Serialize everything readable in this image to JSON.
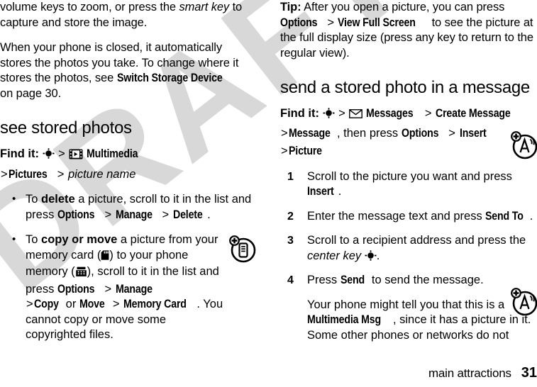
{
  "document": {
    "watermark_text": "DRAFT",
    "watermark_color": "#d8d8d8",
    "text_color": "#000000",
    "background_color": "#ffffff"
  },
  "left_column": {
    "para_continued": {
      "part1": "volume keys to zoom, or press the ",
      "italic1": "smart key",
      "part2": " to capture and store the image."
    },
    "para_storage": {
      "part1": "When your phone is closed, it automatically stores the photos you take. To change where it stores the photos, see ",
      "ui1": "Switch Storage Device",
      "part2": " on page 30."
    },
    "section_heading": "see stored photos",
    "find_it": {
      "label": "Find it:",
      "centerkey_icon": "center-key-icon",
      "sep1": ">",
      "multimedia_icon": "multimedia-film-icon",
      "multimedia": "Multimedia",
      "sep2": ">",
      "pictures": "Pictures",
      "sep3": ">",
      "picture_name": "picture name"
    },
    "bullets": [
      {
        "part1": "To ",
        "bold1": "delete",
        "part2": " a picture, scroll to it in the list and press ",
        "ui1": "Options",
        "sep1": ">",
        "ui2": "Manage",
        "sep2": ">",
        "ui3": "Delete",
        "part3": "."
      },
      {
        "part1": "To ",
        "bold1": "copy or move",
        "part2": " a picture from your memory card (",
        "icon1": "memory-card-icon",
        "part3": ") to your phone memory (",
        "icon2": "phone-memory-icon",
        "part4": "), scroll to it in the list and press ",
        "ui1": "Options",
        "sep1": ">",
        "ui2": "Manage",
        "sep2": ">",
        "ui3": "Copy",
        "or": " or ",
        "ui4": "Move",
        "sep3": ">",
        "ui5": "Memory Card",
        "part5": ". You cannot copy or move some copyrighted files."
      }
    ]
  },
  "right_column": {
    "tip": {
      "label": "Tip:",
      "part1": " After you open a picture, you can press ",
      "ui1": "Options",
      "sep1": ">",
      "ui2": "View Full Screen",
      "part2": " to see the picture at the full display size (press any key to return to the regular view)."
    },
    "section_heading": "send a stored photo in a message",
    "find_it": {
      "label": "Find it:",
      "centerkey_icon": "center-key-icon",
      "sep1": ">",
      "messages_icon": "envelope-icon",
      "messages": "Messages",
      "sep2": ">",
      "create_message": "Create Message",
      "sep3": ">",
      "message": "Message",
      "then_press": ", then press ",
      "options": "Options",
      "sep4": ">",
      "insert": "Insert",
      "sep5": ">",
      "picture": "Picture"
    },
    "steps": [
      {
        "num": "1",
        "part1": "Scroll to the picture you want and press ",
        "ui1": "Insert",
        "part2": "."
      },
      {
        "num": "2",
        "part1": "Enter the message text and press ",
        "ui1": "Send To",
        "part2": "."
      },
      {
        "num": "3",
        "part1": "Scroll to a recipient address and press the ",
        "italic1": "center key",
        "icon1": "center-key-icon",
        "part2": "."
      },
      {
        "num": "4",
        "part1": "Press ",
        "ui1": "Send",
        "part2": " to send the message.",
        "sub": {
          "part1": "Your phone might tell you that this is a ",
          "ui1": "Multimedia Msg",
          "part2": ", since it has a picture in it. Some other phones or networks do not"
        }
      }
    ]
  },
  "margin_icons": [
    {
      "name": "phone-memory-circle-icon"
    },
    {
      "name": "network-alert-circle-icon"
    },
    {
      "name": "network-alert-circle-icon"
    }
  ],
  "footer": {
    "title": "main attractions",
    "page_number": "31"
  }
}
